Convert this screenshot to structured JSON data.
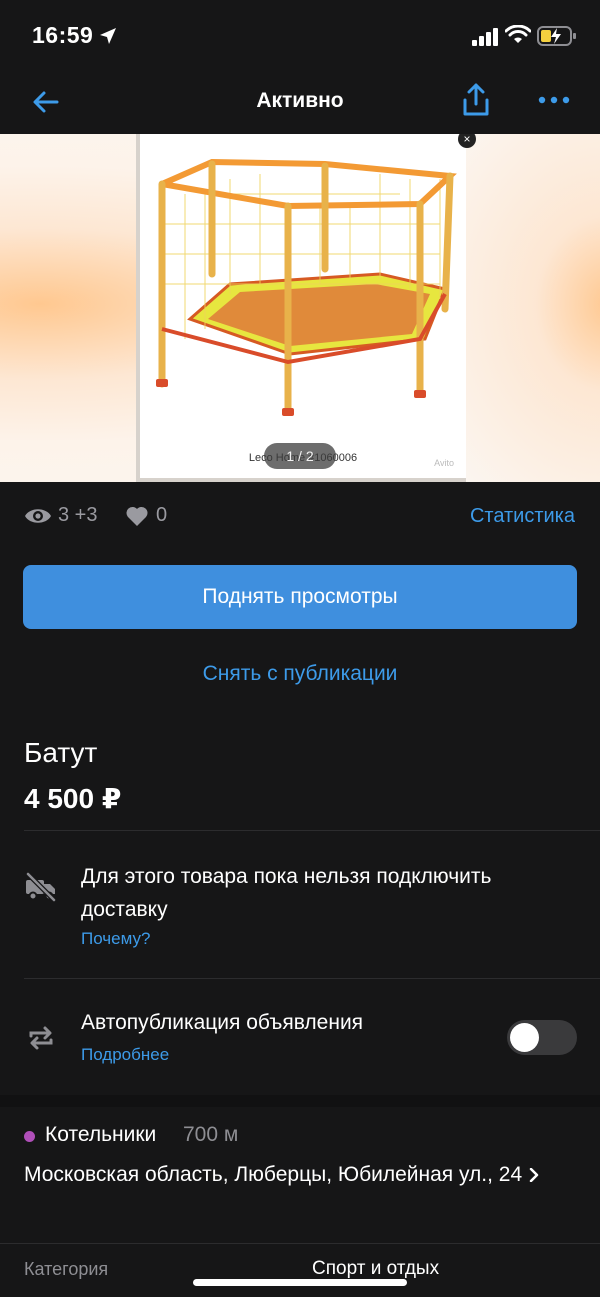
{
  "status_bar": {
    "time": "16:59",
    "icons": [
      "location-arrow-icon",
      "cellular-signal-icon",
      "wifi-icon",
      "battery-charging-icon"
    ]
  },
  "nav": {
    "title": "Активно",
    "back_icon": "arrow-left-icon",
    "share_icon": "share-icon",
    "more_icon": "more-dots-icon"
  },
  "gallery": {
    "counter": "1 / 2",
    "caption": "Leco Home #1060006",
    "watermark": "Avito"
  },
  "stats": {
    "views": "3 +3",
    "likes": "0",
    "statistics_link": "Статистика"
  },
  "actions": {
    "promote": "Поднять просмотры",
    "unpublish": "Снять с публикации"
  },
  "item": {
    "title": "Батут",
    "price": "4 500 ₽"
  },
  "delivery": {
    "text": "Для этого товара пока нельзя подключить доставку",
    "link": "Почему?"
  },
  "autopublish": {
    "text": "Автопубликация объявления",
    "link": "Подробнее",
    "enabled": false
  },
  "location": {
    "metro": "Котельники",
    "distance": "700 м",
    "metro_color": "#b04fb9",
    "address": "Московская область, Люберцы, Юбилейная ул., 24"
  },
  "details": [
    {
      "label": "Категория",
      "value": "Спорт и отдых"
    }
  ],
  "colors": {
    "accent": "#3d9be9",
    "button": "#3f8fde",
    "background": "#161617"
  }
}
